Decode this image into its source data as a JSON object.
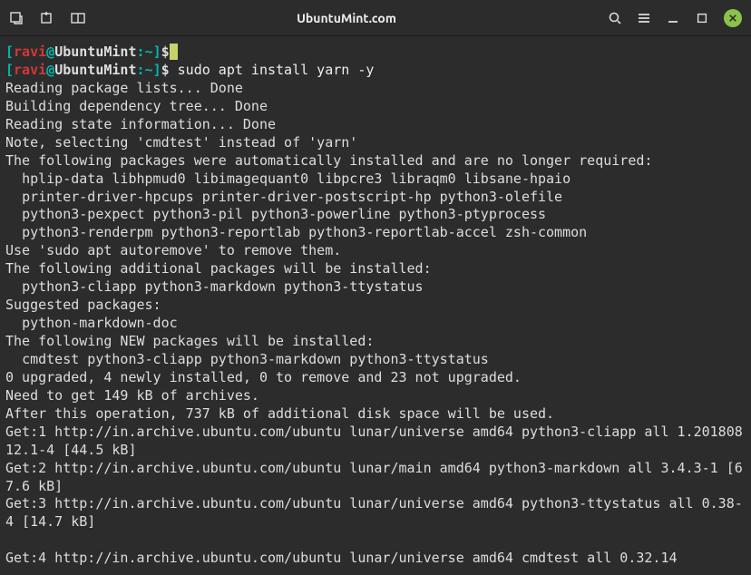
{
  "titlebar": {
    "title": "UbuntuMint.com"
  },
  "prompt": {
    "open": "[",
    "user": "ravi",
    "at": "@",
    "host": "UbuntuMint",
    "colon": ":",
    "path": "~",
    "close": "]",
    "symbol": "$"
  },
  "cursor": " ",
  "command": " sudo apt install yarn -y",
  "output": [
    "Reading package lists... Done",
    "Building dependency tree... Done",
    "Reading state information... Done",
    "Note, selecting 'cmdtest' instead of 'yarn'",
    "The following packages were automatically installed and are no longer required:",
    "  hplip-data libhpmud0 libimagequant0 libpcre3 libraqm0 libsane-hpaio",
    "  printer-driver-hpcups printer-driver-postscript-hp python3-olefile",
    "  python3-pexpect python3-pil python3-powerline python3-ptyprocess",
    "  python3-renderpm python3-reportlab python3-reportlab-accel zsh-common",
    "Use 'sudo apt autoremove' to remove them.",
    "The following additional packages will be installed:",
    "  python3-cliapp python3-markdown python3-ttystatus",
    "Suggested packages:",
    "  python-markdown-doc",
    "The following NEW packages will be installed:",
    "  cmdtest python3-cliapp python3-markdown python3-ttystatus",
    "0 upgraded, 4 newly installed, 0 to remove and 23 not upgraded.",
    "Need to get 149 kB of archives.",
    "After this operation, 737 kB of additional disk space will be used.",
    "Get:1 http://in.archive.ubuntu.com/ubuntu lunar/universe amd64 python3-cliapp all 1.20180812.1-4 [44.5 kB]",
    "Get:2 http://in.archive.ubuntu.com/ubuntu lunar/main amd64 python3-markdown all 3.4.3-1 [67.6 kB]",
    "Get:3 http://in.archive.ubuntu.com/ubuntu lunar/universe amd64 python3-ttystatus all 0.38-4 [14.7 kB]",
    "",
    "Get:4 http://in.archive.ubuntu.com/ubuntu lunar/universe amd64 cmdtest all 0.32.14"
  ]
}
